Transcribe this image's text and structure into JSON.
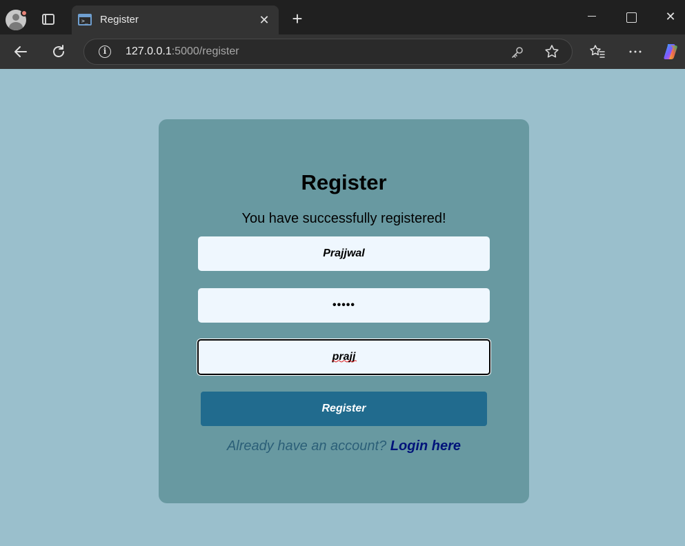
{
  "browser": {
    "tab_title": "Register",
    "url_host": "127.0.0.1",
    "url_rest": ":5000/register",
    "tab_close": "✕",
    "new_tab": "+",
    "window_close": "✕"
  },
  "page": {
    "heading": "Register",
    "message": "You have successfully registered!",
    "fields": {
      "username_value": "Prajjwal",
      "password_value": "•••••",
      "confirm_value": "prajj"
    },
    "button_label": "Register",
    "login_prompt": "Already have an account?",
    "login_link": "Login here"
  },
  "colors": {
    "page_bg": "#9abfcc",
    "card_bg": "#6899a1",
    "input_bg": "#eff7fe",
    "button_bg": "#216b8e",
    "link": "#00137a"
  }
}
